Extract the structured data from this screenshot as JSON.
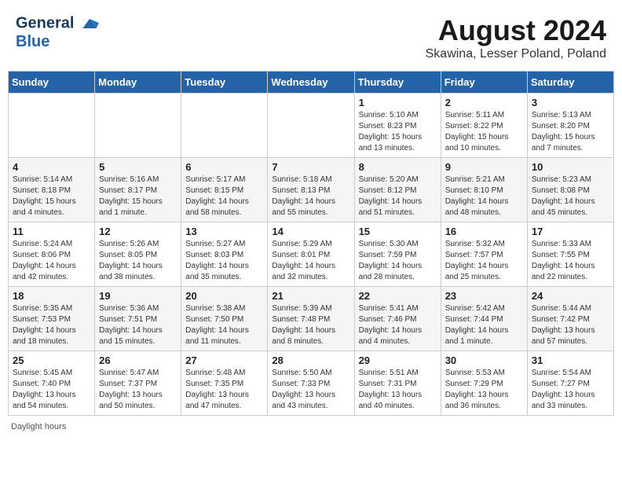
{
  "header": {
    "logo_line1": "General",
    "logo_line2": "Blue",
    "title": "August 2024",
    "subtitle": "Skawina, Lesser Poland, Poland"
  },
  "days_of_week": [
    "Sunday",
    "Monday",
    "Tuesday",
    "Wednesday",
    "Thursday",
    "Friday",
    "Saturday"
  ],
  "weeks": [
    [
      {
        "day": "",
        "info": ""
      },
      {
        "day": "",
        "info": ""
      },
      {
        "day": "",
        "info": ""
      },
      {
        "day": "",
        "info": ""
      },
      {
        "day": "1",
        "info": "Sunrise: 5:10 AM\nSunset: 8:23 PM\nDaylight: 15 hours\nand 13 minutes."
      },
      {
        "day": "2",
        "info": "Sunrise: 5:11 AM\nSunset: 8:22 PM\nDaylight: 15 hours\nand 10 minutes."
      },
      {
        "day": "3",
        "info": "Sunrise: 5:13 AM\nSunset: 8:20 PM\nDaylight: 15 hours\nand 7 minutes."
      }
    ],
    [
      {
        "day": "4",
        "info": "Sunrise: 5:14 AM\nSunset: 8:18 PM\nDaylight: 15 hours\nand 4 minutes."
      },
      {
        "day": "5",
        "info": "Sunrise: 5:16 AM\nSunset: 8:17 PM\nDaylight: 15 hours\nand 1 minute."
      },
      {
        "day": "6",
        "info": "Sunrise: 5:17 AM\nSunset: 8:15 PM\nDaylight: 14 hours\nand 58 minutes."
      },
      {
        "day": "7",
        "info": "Sunrise: 5:18 AM\nSunset: 8:13 PM\nDaylight: 14 hours\nand 55 minutes."
      },
      {
        "day": "8",
        "info": "Sunrise: 5:20 AM\nSunset: 8:12 PM\nDaylight: 14 hours\nand 51 minutes."
      },
      {
        "day": "9",
        "info": "Sunrise: 5:21 AM\nSunset: 8:10 PM\nDaylight: 14 hours\nand 48 minutes."
      },
      {
        "day": "10",
        "info": "Sunrise: 5:23 AM\nSunset: 8:08 PM\nDaylight: 14 hours\nand 45 minutes."
      }
    ],
    [
      {
        "day": "11",
        "info": "Sunrise: 5:24 AM\nSunset: 8:06 PM\nDaylight: 14 hours\nand 42 minutes."
      },
      {
        "day": "12",
        "info": "Sunrise: 5:26 AM\nSunset: 8:05 PM\nDaylight: 14 hours\nand 38 minutes."
      },
      {
        "day": "13",
        "info": "Sunrise: 5:27 AM\nSunset: 8:03 PM\nDaylight: 14 hours\nand 35 minutes."
      },
      {
        "day": "14",
        "info": "Sunrise: 5:29 AM\nSunset: 8:01 PM\nDaylight: 14 hours\nand 32 minutes."
      },
      {
        "day": "15",
        "info": "Sunrise: 5:30 AM\nSunset: 7:59 PM\nDaylight: 14 hours\nand 28 minutes."
      },
      {
        "day": "16",
        "info": "Sunrise: 5:32 AM\nSunset: 7:57 PM\nDaylight: 14 hours\nand 25 minutes."
      },
      {
        "day": "17",
        "info": "Sunrise: 5:33 AM\nSunset: 7:55 PM\nDaylight: 14 hours\nand 22 minutes."
      }
    ],
    [
      {
        "day": "18",
        "info": "Sunrise: 5:35 AM\nSunset: 7:53 PM\nDaylight: 14 hours\nand 18 minutes."
      },
      {
        "day": "19",
        "info": "Sunrise: 5:36 AM\nSunset: 7:51 PM\nDaylight: 14 hours\nand 15 minutes."
      },
      {
        "day": "20",
        "info": "Sunrise: 5:38 AM\nSunset: 7:50 PM\nDaylight: 14 hours\nand 11 minutes."
      },
      {
        "day": "21",
        "info": "Sunrise: 5:39 AM\nSunset: 7:48 PM\nDaylight: 14 hours\nand 8 minutes."
      },
      {
        "day": "22",
        "info": "Sunrise: 5:41 AM\nSunset: 7:46 PM\nDaylight: 14 hours\nand 4 minutes."
      },
      {
        "day": "23",
        "info": "Sunrise: 5:42 AM\nSunset: 7:44 PM\nDaylight: 14 hours\nand 1 minute."
      },
      {
        "day": "24",
        "info": "Sunrise: 5:44 AM\nSunset: 7:42 PM\nDaylight: 13 hours\nand 57 minutes."
      }
    ],
    [
      {
        "day": "25",
        "info": "Sunrise: 5:45 AM\nSunset: 7:40 PM\nDaylight: 13 hours\nand 54 minutes."
      },
      {
        "day": "26",
        "info": "Sunrise: 5:47 AM\nSunset: 7:37 PM\nDaylight: 13 hours\nand 50 minutes."
      },
      {
        "day": "27",
        "info": "Sunrise: 5:48 AM\nSunset: 7:35 PM\nDaylight: 13 hours\nand 47 minutes."
      },
      {
        "day": "28",
        "info": "Sunrise: 5:50 AM\nSunset: 7:33 PM\nDaylight: 13 hours\nand 43 minutes."
      },
      {
        "day": "29",
        "info": "Sunrise: 5:51 AM\nSunset: 7:31 PM\nDaylight: 13 hours\nand 40 minutes."
      },
      {
        "day": "30",
        "info": "Sunrise: 5:53 AM\nSunset: 7:29 PM\nDaylight: 13 hours\nand 36 minutes."
      },
      {
        "day": "31",
        "info": "Sunrise: 5:54 AM\nSunset: 7:27 PM\nDaylight: 13 hours\nand 33 minutes."
      }
    ]
  ],
  "footer": "Daylight hours"
}
